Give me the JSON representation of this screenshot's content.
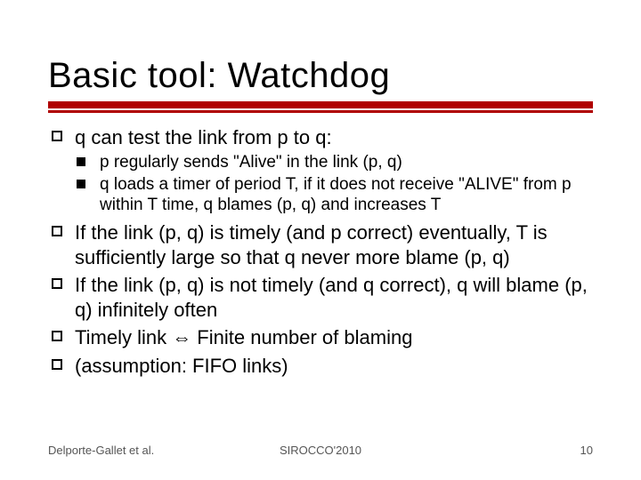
{
  "title": "Basic tool: Watchdog",
  "bullets": {
    "b1": "q can test the link from p to q:",
    "b1_sub": {
      "s1": "p regularly sends \"Alive\" in the link (p, q)",
      "s2": "q loads a timer of period T, if it does not receive \"ALIVE\" from p within T time, q blames (p, q) and increases T"
    },
    "b2": "If the link (p, q) is timely (and p correct) eventually, T is sufficiently large so that q never more blame (p, q)",
    "b3": "If the link (p, q) is not timely (and q correct), q will blame (p, q) infinitely often",
    "b4": "Timely link ⇔ Finite number of blaming",
    "b5": "(assumption: FIFO links)"
  },
  "footer": {
    "left": "Delporte-Gallet et al.",
    "center": "SIROCCO'2010",
    "right": "10"
  }
}
